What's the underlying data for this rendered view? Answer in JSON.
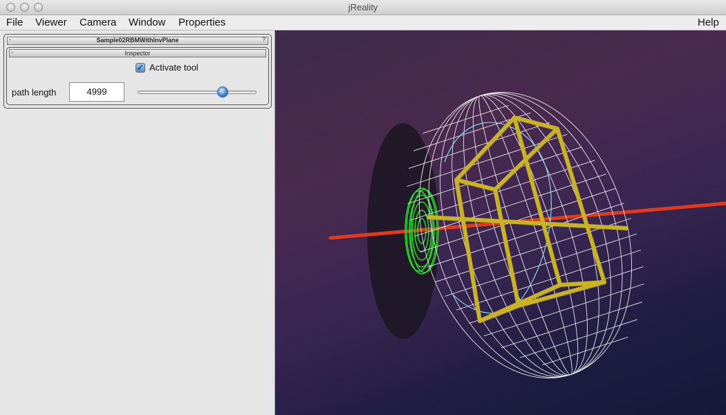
{
  "window": {
    "title": "jReality"
  },
  "menubar": {
    "items": [
      "File",
      "Viewer",
      "Camera",
      "Window",
      "Properties"
    ],
    "help": "Help"
  },
  "panel": {
    "title": "Sample02RBMWithInvPlane",
    "collapse_glyph": "-",
    "help_glyph": "?",
    "inspector": {
      "title": "Inspector",
      "collapse_glyph": "-",
      "activate_tool": {
        "label": "Activate tool",
        "checked": true
      },
      "path_length": {
        "label": "path length",
        "value": "4999"
      },
      "slider": {
        "level": 0.74
      }
    }
  },
  "scene": {
    "colors": {
      "sphere_wire": "#ffffff",
      "box": "#c9b320",
      "axis": "#e23a1a",
      "disk": "#22dd22",
      "cyan_curve": "#7fe0ee",
      "shadow": "#1b1622"
    },
    "objects": [
      "wireframe-ellipsoid",
      "yellow-box-frame",
      "red-axis",
      "green-disk",
      "shadow-plane"
    ]
  }
}
